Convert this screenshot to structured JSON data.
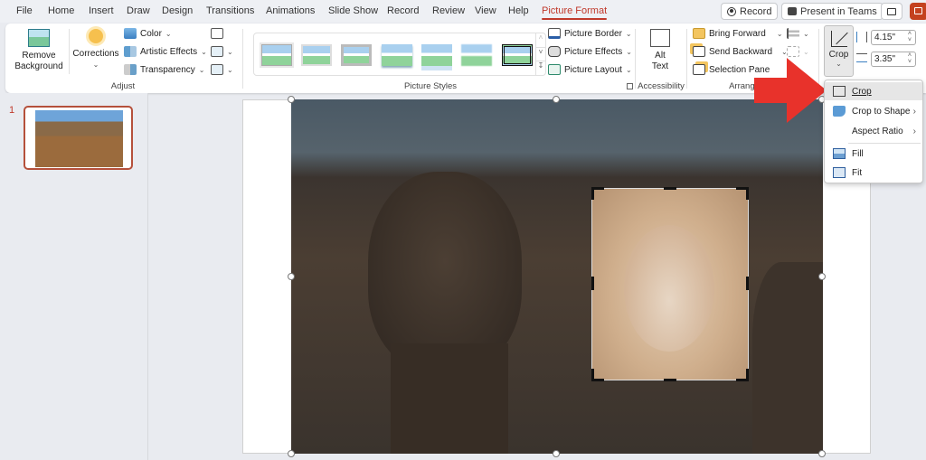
{
  "tabs": [
    "File",
    "Home",
    "Insert",
    "Draw",
    "Design",
    "Transitions",
    "Animations",
    "Slide Show",
    "Record",
    "Review",
    "View",
    "Help",
    "Picture Format"
  ],
  "active_tab": "Picture Format",
  "top_buttons": {
    "record": "Record",
    "present": "Present in Teams"
  },
  "ribbon": {
    "adjust": {
      "label": "Adjust",
      "remove_bg": [
        "Remove",
        "Background"
      ],
      "corrections": "Corrections",
      "color": "Color",
      "artistic": "Artistic Effects",
      "transparency": "Transparency"
    },
    "styles": {
      "label": "Picture Styles",
      "count": 7
    },
    "picture": {
      "border": "Picture Border",
      "effects": "Picture Effects",
      "layout": "Picture Layout"
    },
    "accessibility": {
      "label": "Accessibility",
      "alt": [
        "Alt",
        "Text"
      ]
    },
    "arrange": {
      "label": "Arrange",
      "forward": "Bring Forward",
      "backward": "Send Backward",
      "selection": "Selection Pane"
    },
    "size": {
      "crop": "Crop",
      "height": "4.15\"",
      "width": "3.35\""
    }
  },
  "slides": [
    {
      "number": "1"
    }
  ],
  "crop_menu": {
    "items": [
      {
        "label": "Crop",
        "icon": "crop-icon",
        "submenu": false
      },
      {
        "label": "Crop to Shape",
        "icon": "crop-to-shape-icon",
        "submenu": true
      },
      {
        "label": "Aspect Ratio",
        "icon": "",
        "submenu": true
      },
      {
        "label": "Fill",
        "icon": "fill-icon",
        "submenu": false
      },
      {
        "label": "Fit",
        "icon": "fit-icon",
        "submenu": false
      }
    ]
  },
  "colors": {
    "accent": "#c0392b",
    "arrow": "#e8322b"
  }
}
